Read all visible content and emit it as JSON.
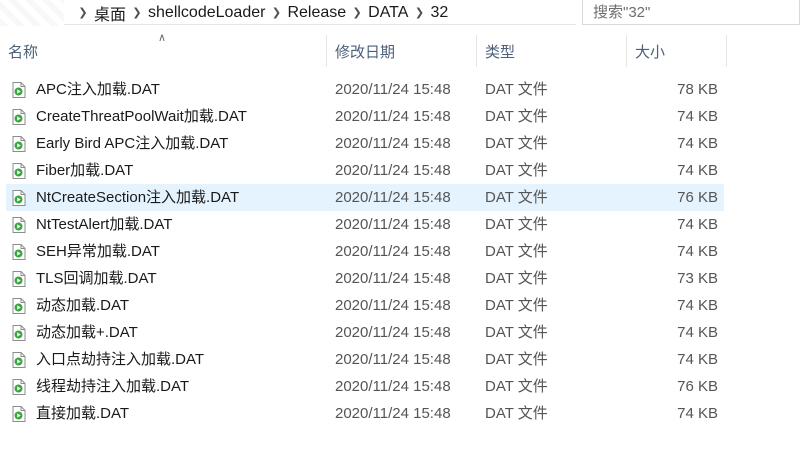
{
  "address_bar": {
    "breadcrumbs": [
      "桌面",
      "shellcodeLoader",
      "Release",
      "DATA",
      "32"
    ],
    "search_placeholder": "搜索\"32\""
  },
  "columns": {
    "name": "名称",
    "date": "修改日期",
    "type": "类型",
    "size": "大小"
  },
  "files": [
    {
      "name": "APC注入加载.DAT",
      "date": "2020/11/24 15:48",
      "type": "DAT 文件",
      "size": "78 KB"
    },
    {
      "name": "CreateThreatPoolWait加载.DAT",
      "date": "2020/11/24 15:48",
      "type": "DAT 文件",
      "size": "74 KB"
    },
    {
      "name": "Early Bird APC注入加载.DAT",
      "date": "2020/11/24 15:48",
      "type": "DAT 文件",
      "size": "74 KB"
    },
    {
      "name": "Fiber加载.DAT",
      "date": "2020/11/24 15:48",
      "type": "DAT 文件",
      "size": "74 KB"
    },
    {
      "name": "NtCreateSection注入加载.DAT",
      "date": "2020/11/24 15:48",
      "type": "DAT 文件",
      "size": "76 KB"
    },
    {
      "name": "NtTestAlert加载.DAT",
      "date": "2020/11/24 15:48",
      "type": "DAT 文件",
      "size": "74 KB"
    },
    {
      "name": "SEH异常加载.DAT",
      "date": "2020/11/24 15:48",
      "type": "DAT 文件",
      "size": "74 KB"
    },
    {
      "name": "TLS回调加载.DAT",
      "date": "2020/11/24 15:48",
      "type": "DAT 文件",
      "size": "73 KB"
    },
    {
      "name": "动态加载.DAT",
      "date": "2020/11/24 15:48",
      "type": "DAT 文件",
      "size": "74 KB"
    },
    {
      "name": "动态加载+.DAT",
      "date": "2020/11/24 15:48",
      "type": "DAT 文件",
      "size": "74 KB"
    },
    {
      "name": "入口点劫持注入加载.DAT",
      "date": "2020/11/24 15:48",
      "type": "DAT 文件",
      "size": "74 KB"
    },
    {
      "name": "线程劫持注入加载.DAT",
      "date": "2020/11/24 15:48",
      "type": "DAT 文件",
      "size": "76 KB"
    },
    {
      "name": "直接加载.DAT",
      "date": "2020/11/24 15:48",
      "type": "DAT 文件",
      "size": "74 KB"
    }
  ],
  "hovered_row_index": 4,
  "colors": {
    "hover_bg": "#e5f3ff",
    "header_text": "#4c607a",
    "icon_green": "#3aa640"
  },
  "icons": {
    "file": "media-file-icon",
    "dropdown": "chevron-down-icon",
    "refresh": "refresh-icon",
    "breadcrumb_separator": "chevron-right-icon",
    "sort": "sort-ascending-icon"
  }
}
